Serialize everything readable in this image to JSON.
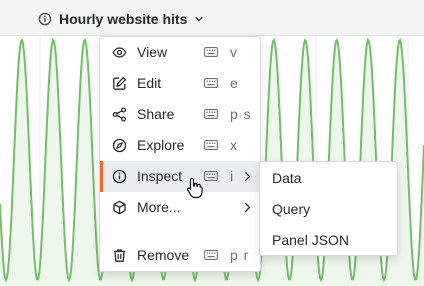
{
  "panel": {
    "title": "Hourly website hits",
    "icons": {
      "info": "info-circle-icon",
      "menu": "chevron-down-icon"
    }
  },
  "menu": {
    "items": [
      {
        "label": "View",
        "shortcut": "v",
        "icon": "eye-icon"
      },
      {
        "label": "Edit",
        "shortcut": "e",
        "icon": "edit-icon"
      },
      {
        "label": "Share",
        "shortcut": "p s",
        "icon": "share-icon"
      },
      {
        "label": "Explore",
        "shortcut": "x",
        "icon": "compass-icon"
      },
      {
        "label": "Inspect",
        "shortcut": "i",
        "icon": "info-circle-icon",
        "active": true,
        "has_submenu": true
      },
      {
        "label": "More...",
        "shortcut": "",
        "icon": "cube-icon",
        "has_submenu": true
      },
      {
        "label": "Remove",
        "shortcut": "p r",
        "icon": "trash-icon"
      }
    ]
  },
  "submenu": {
    "items": [
      {
        "label": "Data"
      },
      {
        "label": "Query"
      },
      {
        "label": "Panel JSON"
      }
    ]
  },
  "colors": {
    "series_line": "#73bf69",
    "series_fill": "#eef7ec",
    "active_accent": "#f06a2a",
    "header_bg": "#f4f5f5"
  },
  "cursor": {
    "type": "hand-pointer-icon"
  }
}
